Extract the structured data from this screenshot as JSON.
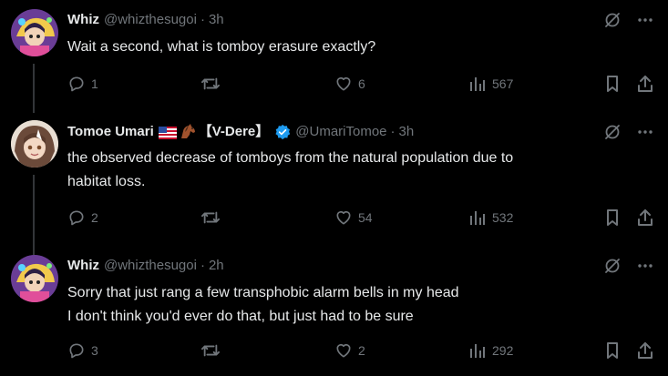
{
  "tweets": [
    {
      "display_name": "Whiz",
      "handle": "@whizthesugoi",
      "separator": "·",
      "time": "3h",
      "text_lines": [
        "Wait a second, what is tomboy erasure exactly?"
      ],
      "replies": "1",
      "reposts": "",
      "likes": "6",
      "views": "567"
    },
    {
      "display_name": "Tomoe Umari",
      "name_tag": "【V-Dere】",
      "handle": "@UmariTomoe",
      "separator": "·",
      "time": "3h",
      "verified": true,
      "text_lines": [
        "the observed decrease of tomboys from the natural population due to",
        "habitat loss."
      ],
      "replies": "2",
      "reposts": "",
      "likes": "54",
      "views": "532"
    },
    {
      "display_name": "Whiz",
      "handle": "@whizthesugoi",
      "separator": "·",
      "time": "2h",
      "text_lines": [
        "Sorry that just rang a few transphobic alarm bells in my head",
        "I don't think you'd ever do that, but just had to be sure"
      ],
      "replies": "3",
      "reposts": "",
      "likes": "2",
      "views": "292"
    }
  ],
  "icons": {
    "grok": "grok-icon",
    "more": "more-icon",
    "reply": "reply-icon",
    "repost": "repost-icon",
    "like": "like-icon",
    "views": "views-icon",
    "bookmark": "bookmark-icon",
    "share": "share-icon",
    "flag": "us-flag-icon",
    "horse": "horse-icon",
    "verified": "verified-badge-icon"
  },
  "colors": {
    "background": "#000000",
    "text": "#e7e9ea",
    "muted": "#71767b",
    "verified": "#1d9bf0",
    "thread_line": "#333639"
  }
}
